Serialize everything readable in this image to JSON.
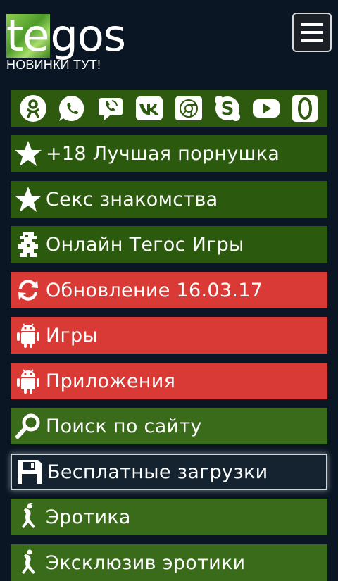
{
  "header": {
    "logo_part1": "te",
    "logo_part2": "gos",
    "tagline": "НОВИНКИ ТУТ!"
  },
  "social_icons": [
    "odnoklassniki-icon",
    "whatsapp-icon",
    "viber-icon",
    "vk-icon",
    "chrome-icon",
    "skype-icon",
    "youtube-icon",
    "opera-icon"
  ],
  "menu": {
    "items": [
      {
        "label": "+18 Лучшая порнушка",
        "icon": "star-icon"
      },
      {
        "label": "Секс знакомства",
        "icon": "star-icon"
      },
      {
        "label": "Онлайн Тегос Игры",
        "icon": "pixel-character-icon"
      },
      {
        "label": "Обновление 16.03.17",
        "icon": "refresh-icon"
      },
      {
        "label": "Игры",
        "icon": "android-icon"
      },
      {
        "label": "Приложения",
        "icon": "android-icon"
      },
      {
        "label": "Поиск по сайту",
        "icon": "search-icon"
      },
      {
        "label": "Бесплатные загрузки",
        "icon": "floppy-icon"
      },
      {
        "label": "Эротика",
        "icon": "dancer-icon"
      },
      {
        "label": "Эксклюзив эротики",
        "icon": "dancer-icon"
      }
    ]
  },
  "colors": {
    "background": "#0b1624",
    "green": "#2b5a0e",
    "green_light": "#3a6b1a",
    "red": "#d93a35",
    "dark_item": "#14232f"
  }
}
